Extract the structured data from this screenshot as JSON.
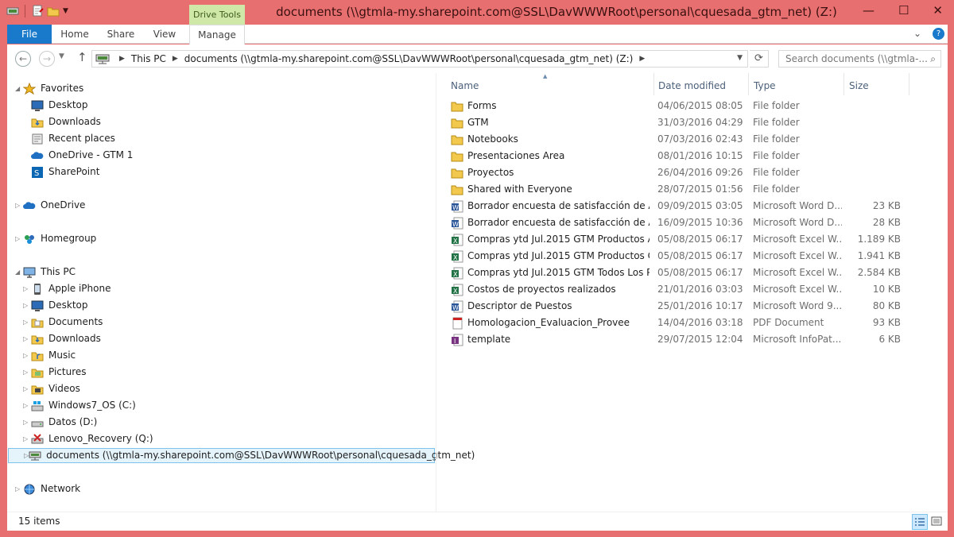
{
  "window": {
    "title": "documents (\\\\gtmla-my.sharepoint.com@SSL\\DavWWWRoot\\personal\\cquesada_gtm_net) (Z:)",
    "context_tab_group": "Drive Tools"
  },
  "ribbon": {
    "tabs": [
      "File",
      "Home",
      "Share",
      "View",
      "Manage"
    ]
  },
  "address": {
    "segments": [
      "This PC",
      "documents (\\\\gtmla-my.sharepoint.com@SSL\\DavWWWRoot\\personal\\cquesada_gtm_net) (Z:)"
    ],
    "search_placeholder": "Search documents (\\\\gtmla-..."
  },
  "navpane": {
    "favorites": {
      "label": "Favorites",
      "items": [
        "Desktop",
        "Downloads",
        "Recent places",
        "OneDrive - GTM 1",
        "SharePoint"
      ]
    },
    "onedrive": "OneDrive",
    "homegroup": "Homegroup",
    "thispc": {
      "label": "This PC",
      "items": [
        "Apple iPhone",
        "Desktop",
        "Documents",
        "Downloads",
        "Music",
        "Pictures",
        "Videos",
        "Windows7_OS (C:)",
        "Datos (D:)",
        "Lenovo_Recovery (Q:)",
        "documents (\\\\gtmla-my.sharepoint.com@SSL\\DavWWWRoot\\personal\\cquesada_gtm_net)"
      ]
    },
    "network": "Network"
  },
  "filelist": {
    "columns": {
      "name": "Name",
      "date": "Date modified",
      "type": "Type",
      "size": "Size"
    },
    "rows": [
      {
        "name": "Forms",
        "date": "04/06/2015 08:05 a...",
        "type": "File folder",
        "size": "",
        "icon": "folder"
      },
      {
        "name": "GTM",
        "date": "31/03/2016 04:29 ...",
        "type": "File folder",
        "size": "",
        "icon": "folder"
      },
      {
        "name": "Notebooks",
        "date": "07/03/2016 02:43 ...",
        "type": "File folder",
        "size": "",
        "icon": "folder"
      },
      {
        "name": "Presentaciones Area",
        "date": "08/01/2016 10:15 a...",
        "type": "File folder",
        "size": "",
        "icon": "folder"
      },
      {
        "name": "Proyectos",
        "date": "26/04/2016 09:26 a...",
        "type": "File folder",
        "size": "",
        "icon": "folder"
      },
      {
        "name": "Shared with Everyone",
        "date": "28/07/2015 01:56 ...",
        "type": "File folder",
        "size": "",
        "icon": "folder"
      },
      {
        "name": "Borrador encuesta de satisfacción de Áre...",
        "date": "09/09/2015 03:05 ...",
        "type": "Microsoft Word D...",
        "size": "23 KB",
        "icon": "word"
      },
      {
        "name": "Borrador encuesta de satisfacción de Áre...",
        "date": "16/09/2015 10:36 a...",
        "type": "Microsoft Word D...",
        "size": "28 KB",
        "icon": "word"
      },
      {
        "name": "Compras ytd Jul.2015 GTM Productos A ...",
        "date": "05/08/2015 06:17 ...",
        "type": "Microsoft Excel W...",
        "size": "1.189 KB",
        "icon": "excel"
      },
      {
        "name": "Compras ytd Jul.2015 GTM Productos C",
        "date": "05/08/2015 06:17 ...",
        "type": "Microsoft Excel W...",
        "size": "1.941 KB",
        "icon": "excel"
      },
      {
        "name": "Compras ytd Jul.2015 GTM Todos Los Pr...",
        "date": "05/08/2015 06:17 ...",
        "type": "Microsoft Excel W...",
        "size": "2.584 KB",
        "icon": "excel"
      },
      {
        "name": "Costos de proyectos realizados",
        "date": "21/01/2016 03:03 ...",
        "type": "Microsoft Excel W...",
        "size": "10 KB",
        "icon": "excel"
      },
      {
        "name": "Descriptor de Puestos",
        "date": "25/01/2016 10:17 a...",
        "type": "Microsoft Word 9...",
        "size": "80 KB",
        "icon": "word"
      },
      {
        "name": "Homologacion_Evaluacion_Provee",
        "date": "14/04/2016 03:18 ...",
        "type": "PDF Document",
        "size": "93 KB",
        "icon": "pdf"
      },
      {
        "name": "template",
        "date": "29/07/2015 12:04 ...",
        "type": "Microsoft InfoPat...",
        "size": "6 KB",
        "icon": "infopath"
      }
    ]
  },
  "status": {
    "item_count": "15 items"
  },
  "colors": {
    "title_bar": "#e86f6f",
    "file_tab": "#1979ca",
    "drive_tools": "#cfe8a8",
    "selection": "#e5f3fb"
  }
}
